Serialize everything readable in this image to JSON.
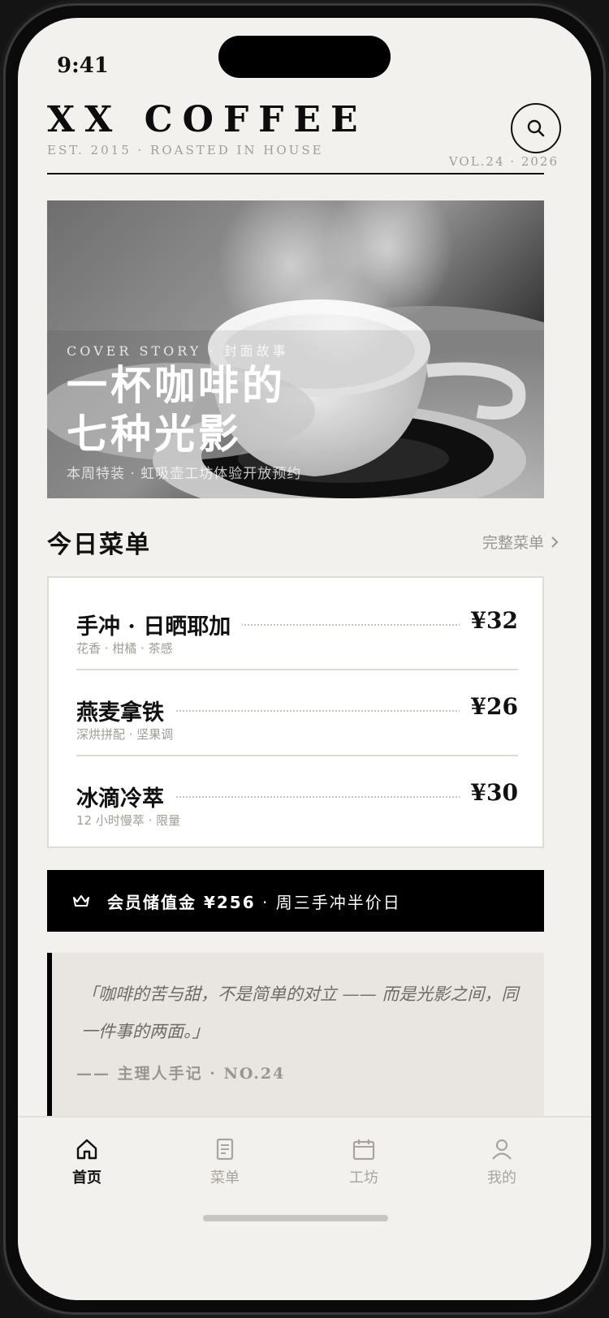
{
  "status": {
    "time": "9:41"
  },
  "header": {
    "brand": "XX COFFEE",
    "tagline": "EST. 2015 · ROASTED IN HOUSE",
    "volume": "VOL.24 · 2026",
    "search_icon": "search-icon"
  },
  "hero": {
    "kicker": "COVER STORY · 封面故事",
    "title_line1": "一杯咖啡的",
    "title_line2": "七种光影",
    "note": "本周特装 · 虹吸壶工坊体验开放预约"
  },
  "menu_section": {
    "title": "今日菜单",
    "link_label": "完整菜单",
    "items": [
      {
        "name": "手冲 · 日晒耶加",
        "desc": "花香 · 柑橘 · 茶感",
        "price": "¥32"
      },
      {
        "name": "燕麦拿铁",
        "desc": "深烘拼配 · 坚果调",
        "price": "¥26"
      },
      {
        "name": "冰滴冷萃",
        "desc": "12 小时慢萃 · 限量",
        "price": "¥30"
      }
    ]
  },
  "promo": {
    "icon": "crown-icon",
    "highlight": "会员储值金 ¥256",
    "text": " · 周三手冲半价日"
  },
  "quote": {
    "text": "「咖啡的苦与甜，不是简单的对立 —— 而是光影之间，同一件事的两面。」",
    "author": "—— 主理人手记 · NO.24"
  },
  "tabbar": {
    "tabs": [
      {
        "label": "首页",
        "icon": "home-icon",
        "active": true
      },
      {
        "label": "菜单",
        "icon": "menu-doc-icon",
        "active": false
      },
      {
        "label": "工坊",
        "icon": "calendar-icon",
        "active": false
      },
      {
        "label": "我的",
        "icon": "user-icon",
        "active": false
      }
    ]
  },
  "colors": {
    "background": "#f3f1ee",
    "ink": "#111111",
    "muted": "#a19d97",
    "card": "#ffffff",
    "quote_bg": "#e9e6e1"
  }
}
